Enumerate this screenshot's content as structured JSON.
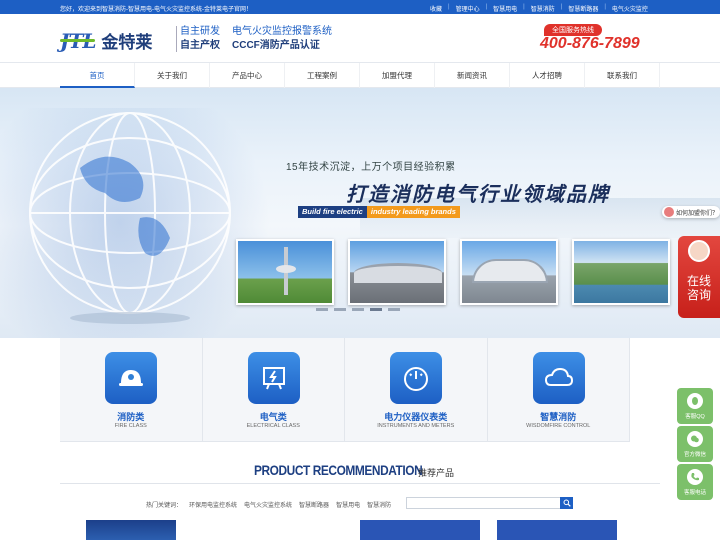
{
  "topbar": {
    "welcome": "您好，欢迎来到智慧消防-智慧用电-电气火灾监控系统-金特莱电子官网！",
    "links": [
      "收藏",
      "管理中心",
      "智慧用电",
      "智慧消防",
      "智慧断路器",
      "电气火灾监控"
    ]
  },
  "header": {
    "logo_mark": "JTL",
    "logo_cn": "金特莱",
    "slogan_left": [
      "自主研发",
      "自主产权"
    ],
    "slogan_right": [
      "电气火灾监控报警系统",
      "CCCF消防产品认证"
    ],
    "hotline_label": "全国服务热线",
    "hotline_number": "400-876-7899"
  },
  "nav": {
    "items": [
      "首页",
      "关于我们",
      "产品中心",
      "工程案例",
      "加盟代理",
      "新闻资讯",
      "人才招聘",
      "联系我们"
    ],
    "active_index": 0
  },
  "banner": {
    "sub": "15年技术沉淀，上万个项目经验积累",
    "main": "打造消防电气行业领域品牌",
    "en_left": "Build fire electric",
    "en_right": "industry leading brands",
    "slide_count": 5,
    "active_slide": 3
  },
  "features": [
    {
      "title": "消防类",
      "en": "FIRE CLASS",
      "icon": "helmet-icon"
    },
    {
      "title": "电气类",
      "en": "ELECTRICAL CLASS",
      "icon": "lightning-board-icon"
    },
    {
      "title": "电力仪器仪表类",
      "en": "INSTRUMENTS AND METERS",
      "icon": "gauge-icon"
    },
    {
      "title": "智慧消防",
      "en": "WISDOMFIRE CONTROL",
      "icon": "cloud-icon"
    }
  ],
  "products": {
    "heading_en": "PRODUCT RECOMMENDATION",
    "heading_cn": "推荐产品",
    "keywords_label": "热门关键词：",
    "keywords": [
      "环保用电监控系统",
      "电气火灾监控系统",
      "智慧断路器",
      "智慧用电",
      "智慧消防"
    ],
    "search_placeholder": ""
  },
  "float": {
    "consult": "如何加盟你们？",
    "online": [
      "在线",
      "咨询"
    ],
    "side_buttons": [
      "客服QQ",
      "官方微信",
      "客服电话"
    ]
  },
  "colors": {
    "brand_blue": "#1d5fc4",
    "accent_red": "#e0322b",
    "accent_orange": "#f39a1c",
    "side_green": "#7cc06a"
  }
}
